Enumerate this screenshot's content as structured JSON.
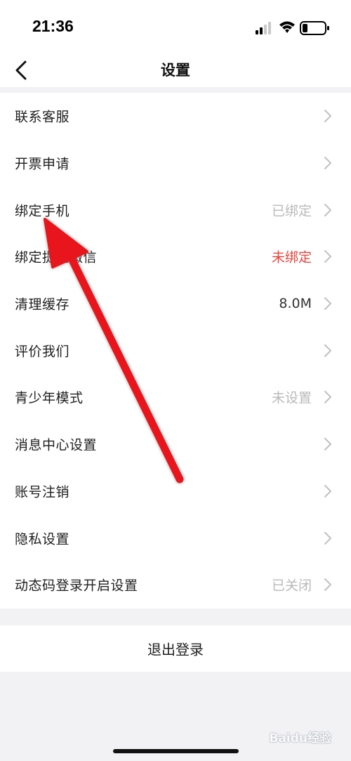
{
  "status_bar": {
    "time": "21:36"
  },
  "header": {
    "title": "设置"
  },
  "settings": [
    {
      "label": "联系客服",
      "value": "",
      "value_style": "muted"
    },
    {
      "label": "开票申请",
      "value": "",
      "value_style": "muted"
    },
    {
      "label": "绑定手机",
      "value": "已绑定",
      "value_style": "muted"
    },
    {
      "label": "绑定提现微信",
      "value": "未绑定",
      "value_style": "red"
    },
    {
      "label": "清理缓存",
      "value": "8.0M",
      "value_style": "dark"
    },
    {
      "label": "评价我们",
      "value": "",
      "value_style": "muted"
    },
    {
      "label": "青少年模式",
      "value": "未设置",
      "value_style": "muted"
    },
    {
      "label": "消息中心设置",
      "value": "",
      "value_style": "muted"
    },
    {
      "label": "账号注销",
      "value": "",
      "value_style": "muted"
    },
    {
      "label": "隐私设置",
      "value": "",
      "value_style": "muted"
    },
    {
      "label": "动态码登录开启设置",
      "value": "已关闭",
      "value_style": "muted"
    }
  ],
  "logout": {
    "label": "退出登录"
  },
  "watermark": {
    "text": "Baidu经验"
  },
  "colors": {
    "accent_red": "#e8433b",
    "muted_text": "#b9b9b9",
    "arrow": "#e8131b"
  }
}
